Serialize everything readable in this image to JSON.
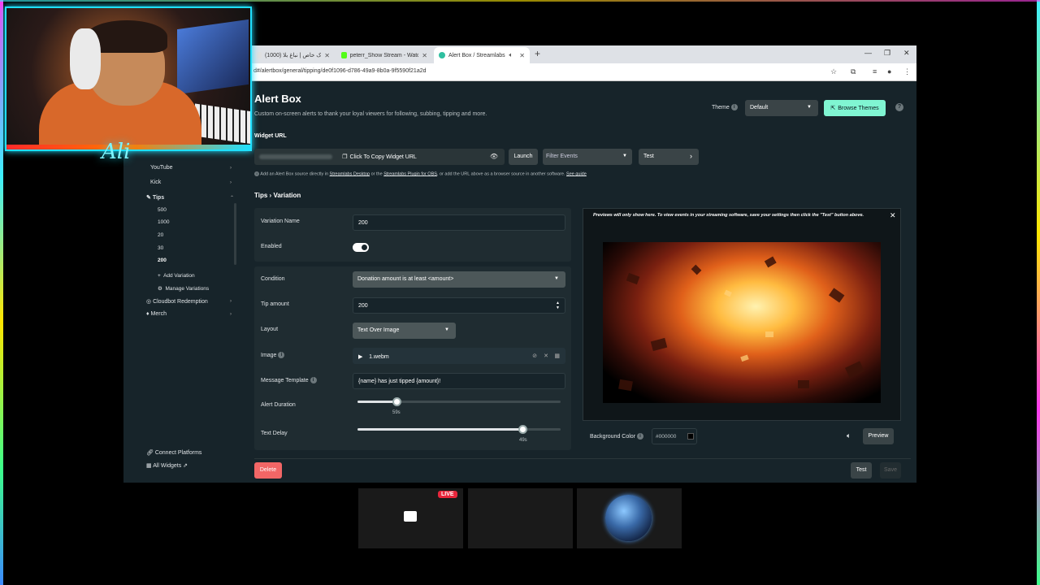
{
  "browser": {
    "tabs": [
      {
        "label": "سترم باک خاص | نباغ بلا (1000)",
        "favicon_color": "#e0e0e0"
      },
      {
        "label": "peterr_Show Stream - Watch Li...",
        "favicon_color": "#53fc18"
      },
      {
        "label": "Alert Box / Streamlabs",
        "favicon_color": "#2fbfa0"
      }
    ],
    "url": "d#/alertbox/general/tipping/de0f1096-d786-49a9-8b0a-9f5590f21a2d"
  },
  "webcam": {
    "signature": "Ali"
  },
  "header": {
    "title": "Alert Box",
    "subtitle": "Custom on-screen alerts to thank your loyal viewers for following, subbing, tipping and more.",
    "theme_label": "Theme",
    "theme_value": "Default",
    "browse_themes": "Browse Themes"
  },
  "widget": {
    "label": "Widget URL",
    "copy_label": "Click To Copy Widget URL",
    "launch": "Launch",
    "filter_placeholder": "Filter Events",
    "test": "Test",
    "info_prefix": "Add an Alert Box source directly in",
    "info_link1": "Streamlabs Desktop",
    "info_mid": "or the",
    "info_link2": "Streamlabs Plugin for OBS",
    "info_suffix": ", or add the URL above as a browser source in another software.",
    "info_link3": "See guide"
  },
  "breadcrumb": {
    "parent": "Tips",
    "sep": "›",
    "current": "Variation"
  },
  "sidebar": {
    "items": [
      {
        "label": "YouTube"
      },
      {
        "label": "Kick"
      },
      {
        "label": "Tips"
      }
    ],
    "tip_variations": [
      "500",
      "1000",
      "20",
      "30",
      "200"
    ],
    "add_variation": "Add Variation",
    "manage_variations": "Manage Variations",
    "cloudbot": "Cloudbot Redemption",
    "merch": "Merch",
    "connect_platforms": "Connect Platforms",
    "all_widgets": "All Widgets"
  },
  "form": {
    "variation_name_label": "Variation Name",
    "variation_name": "200",
    "enabled_label": "Enabled",
    "condition_label": "Condition",
    "condition_value": "Donation amount is at least <amount>",
    "tip_amount_label": "Tip amount",
    "tip_amount": "200",
    "layout_label": "Layout",
    "layout_value": "Text Over Image",
    "image_label": "Image",
    "image_file": "1.webm",
    "message_label": "Message Template",
    "message_value": "{name} has just tipped {amount}!",
    "duration_label": "Alert Duration",
    "duration_value": "59s",
    "duration_fraction": 0.19,
    "text_delay_label": "Text Delay",
    "text_delay_value": "49s",
    "text_delay_fraction": 0.81
  },
  "preview": {
    "note": "Previews will only show here. To view events in your streaming software, save your settings then click the \"Test\" button above.",
    "bg_label": "Background Color",
    "bg_value": "#000000",
    "preview_btn": "Preview"
  },
  "footer": {
    "delete": "Delete",
    "test": "Test",
    "save": "Save"
  },
  "thumbnails": {
    "live": "LIVE"
  },
  "colors": {
    "accent": "#80f5d2",
    "danger": "#f26666",
    "panel": "#1f2c31",
    "page": "#17242a"
  }
}
